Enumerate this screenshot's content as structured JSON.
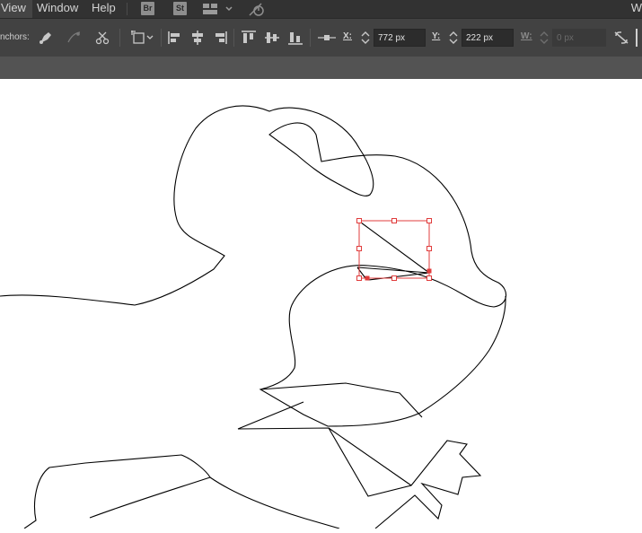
{
  "menu": {
    "view": "View",
    "window": "Window",
    "help": "Help",
    "bridge_badge": "Br",
    "stock_badge": "St",
    "workspace_label": "W"
  },
  "control_bar": {
    "anchors_label": "nchors:",
    "x_label": "X:",
    "x_value": "772 px",
    "y_label": "Y:",
    "y_value": "222 px",
    "w_label": "W:",
    "w_value": "0 px"
  },
  "icons": [
    "arrange-documents-icon",
    "sync-settings-icon",
    "convert-anchor-icon",
    "handle-anchor-icon",
    "cut-path-icon",
    "transform-icon",
    "align-left-icon",
    "align-horizontal-center-icon",
    "align-right-icon",
    "align-top-icon",
    "align-vertical-center-icon",
    "align-bottom-icon",
    "reference-point-icon",
    "stepper-icon",
    "constrain-proportions-icon"
  ],
  "colors": {
    "menubar": "#323232",
    "control_bar": "#424242",
    "selection": "#e03c3c",
    "stroke": "#000000"
  }
}
